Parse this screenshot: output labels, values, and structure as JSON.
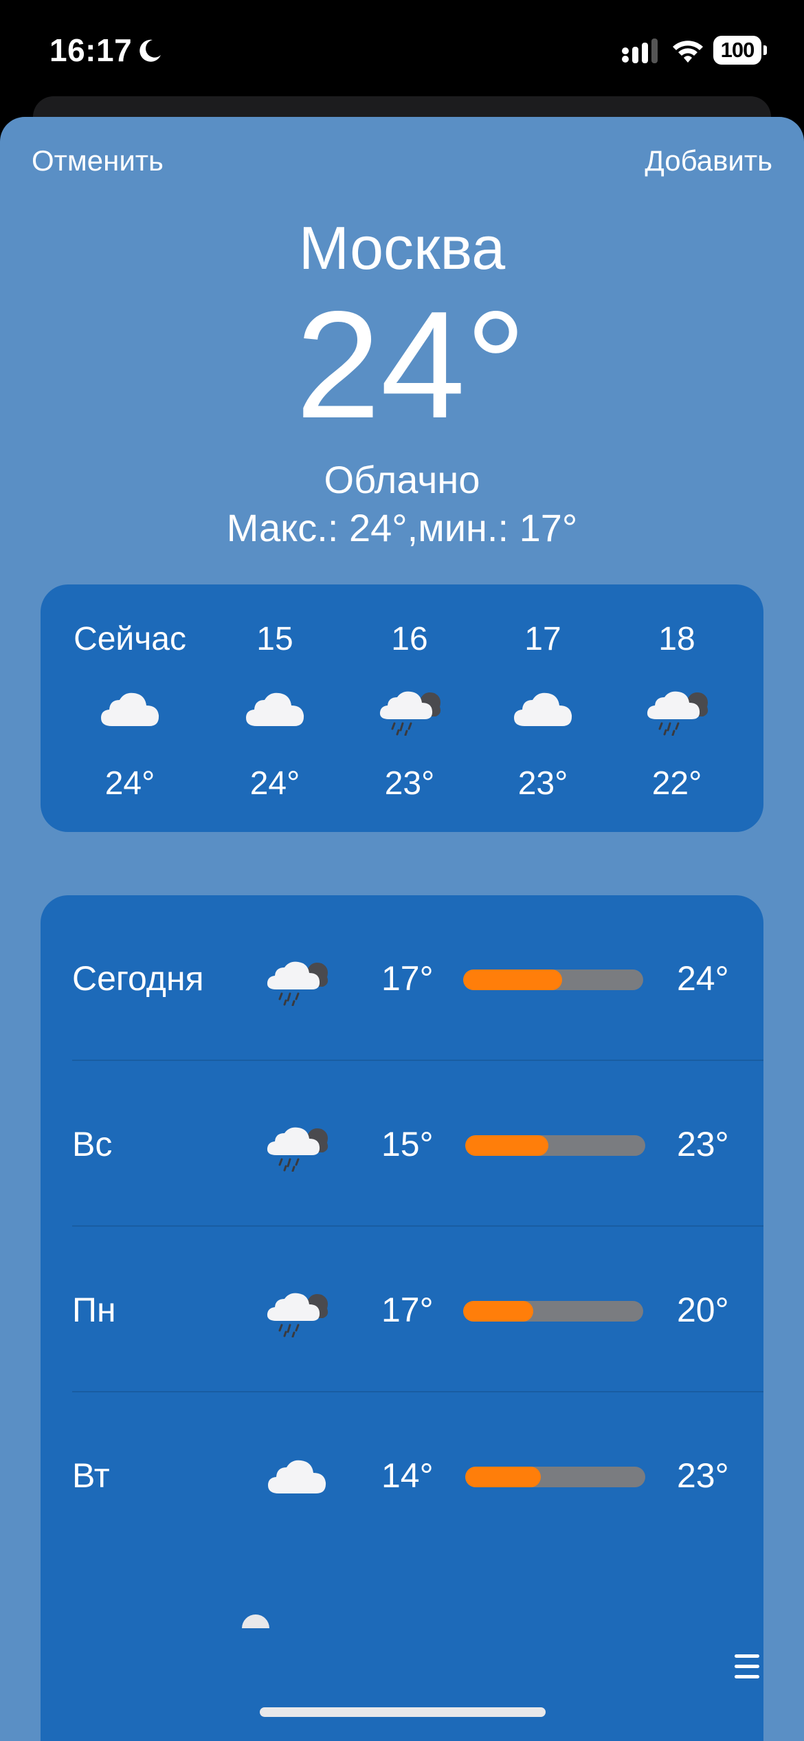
{
  "status_bar": {
    "time": "16:17",
    "battery": "100"
  },
  "nav": {
    "cancel_label": "Отменить",
    "add_label": "Добавить"
  },
  "location": {
    "city": "Москва",
    "temperature": "24°",
    "condition": "Облачно",
    "high_low": "Макс.: 24°,мин.: 17°"
  },
  "hourly": [
    {
      "label": "Сейчас",
      "icon": "cloud-icon",
      "temp": "24°"
    },
    {
      "label": "15",
      "icon": "cloud-icon",
      "temp": "24°"
    },
    {
      "label": "16",
      "icon": "cloud-rain-icon",
      "temp": "23°"
    },
    {
      "label": "17",
      "icon": "cloud-icon",
      "temp": "23°"
    },
    {
      "label": "18",
      "icon": "cloud-rain-icon",
      "temp": "22°"
    }
  ],
  "daily": [
    {
      "day": "Сегодня",
      "icon": "cloud-rain-icon",
      "low": "17°",
      "high": "24°",
      "range_start": 0.0,
      "range_end": 0.55
    },
    {
      "day": "Вс",
      "icon": "cloud-rain-icon",
      "low": "15°",
      "high": "23°",
      "range_start": 0.0,
      "range_end": 0.46
    },
    {
      "day": "Пн",
      "icon": "cloud-rain-icon",
      "low": "17°",
      "high": "20°",
      "range_start": 0.0,
      "range_end": 0.39
    },
    {
      "day": "Вт",
      "icon": "cloud-icon",
      "low": "14°",
      "high": "23°",
      "range_start": 0.0,
      "range_end": 0.42
    }
  ],
  "colors": {
    "sheet": "#5a8fc5",
    "card": "#1d6ab9",
    "range_fill": "#ff7e0a",
    "range_track": "#7a7c80"
  }
}
